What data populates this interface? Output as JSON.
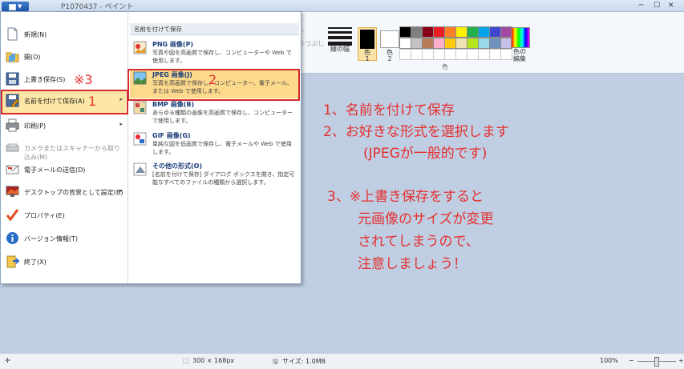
{
  "titlebar": {
    "title": "P1070437 - ペイント",
    "controls": {
      "min": "─",
      "max": "☐",
      "close": "✕"
    }
  },
  "ribbon": {
    "fragments": [
      "ト",
      "りつぶし"
    ],
    "line_width_label": "線の幅",
    "color1_label": "色",
    "color1_num": "1",
    "color2_label": "色",
    "color2_num": "2",
    "edit_colors_label": "色の\n編集",
    "group_label": "色",
    "palette_row1": [
      "#000000",
      "#7f7f7f",
      "#880015",
      "#ed1c24",
      "#ff7f27",
      "#fff200",
      "#22b14c",
      "#00a2e8",
      "#3f48cc",
      "#a349a4"
    ],
    "palette_row2": [
      "#ffffff",
      "#c3c3c3",
      "#b97a57",
      "#ffaec9",
      "#ffc90e",
      "#efe4b0",
      "#b5e61d",
      "#99d9ea",
      "#7092be",
      "#c8bfe7"
    ]
  },
  "menu": {
    "items": [
      {
        "label": "新規(N)",
        "icon": "new-doc-icon",
        "interactable": true
      },
      {
        "label": "開(O)",
        "icon": "open-folder-icon",
        "interactable": true
      },
      {
        "label": "上書き保存(S)",
        "icon": "save-icon",
        "interactable": true
      },
      {
        "label": "名前を付けて保存(A)",
        "icon": "save-as-icon",
        "interactable": true,
        "arrow": "▸",
        "selected": true
      },
      {
        "label": "印刷(P)",
        "icon": "printer-icon",
        "interactable": true,
        "arrow": "▸"
      },
      {
        "label": "カメラまたはスキャナーから取り込み(M)",
        "icon": "scanner-icon",
        "interactable": false,
        "disabled": true
      },
      {
        "label": "電子メールの送信(D)",
        "icon": "email-icon",
        "interactable": true
      },
      {
        "label": "デスクトップの背景として設定(B)",
        "icon": "desktop-icon",
        "interactable": true,
        "arrow": "▸"
      },
      {
        "label": "プロパティ(E)",
        "icon": "checkmark-icon",
        "interactable": true
      },
      {
        "label": "バージョン情報(T)",
        "icon": "info-icon",
        "interactable": true
      },
      {
        "label": "終了(X)",
        "icon": "exit-icon",
        "interactable": true
      }
    ],
    "submenu": {
      "title": "名前を付けて保存",
      "items": [
        {
          "name": "PNG 画像(P)",
          "desc": "写真や図を高画質で保存し、コンピューターや Web で使用します。",
          "icon": "png-icon"
        },
        {
          "name": "JPEG 画像(J)",
          "desc": "写真を高画質で保存し、コンピューター、電子メール、または Web で使用します。",
          "icon": "jpeg-icon",
          "selected": true
        },
        {
          "name": "BMP 画像(B)",
          "desc": "あらゆる種類の画像を高画質で保存し、コンピューターで使用します。",
          "icon": "bmp-icon"
        },
        {
          "name": "GIF 画像(G)",
          "desc": "単純な図を低画質で保存し、電子メールや Web で使用します。",
          "icon": "gif-icon"
        },
        {
          "name": "その他の形式(O)",
          "desc": "[名前を付けて保存] ダイアログ ボックスを開き、指定可能なすべてのファイルの種類から選択します。",
          "icon": "other-format-icon"
        }
      ]
    }
  },
  "annotations": {
    "mark_save": "※3",
    "mark_save_as": "1",
    "mark_jpeg": "2",
    "lines": [
      "1、名前を付けて保存",
      "2、お好きな形式を選択します",
      "(JPEGが一般的です)",
      "3、※上書き保存をすると",
      "元画像のサイズが変更",
      "されてしまうので、",
      "注意しましょう！"
    ]
  },
  "status": {
    "size": "300 × 168px",
    "file_size": "サイズ: 1.0MB",
    "zoom": "100%",
    "zoom_fraction": 0.5
  }
}
